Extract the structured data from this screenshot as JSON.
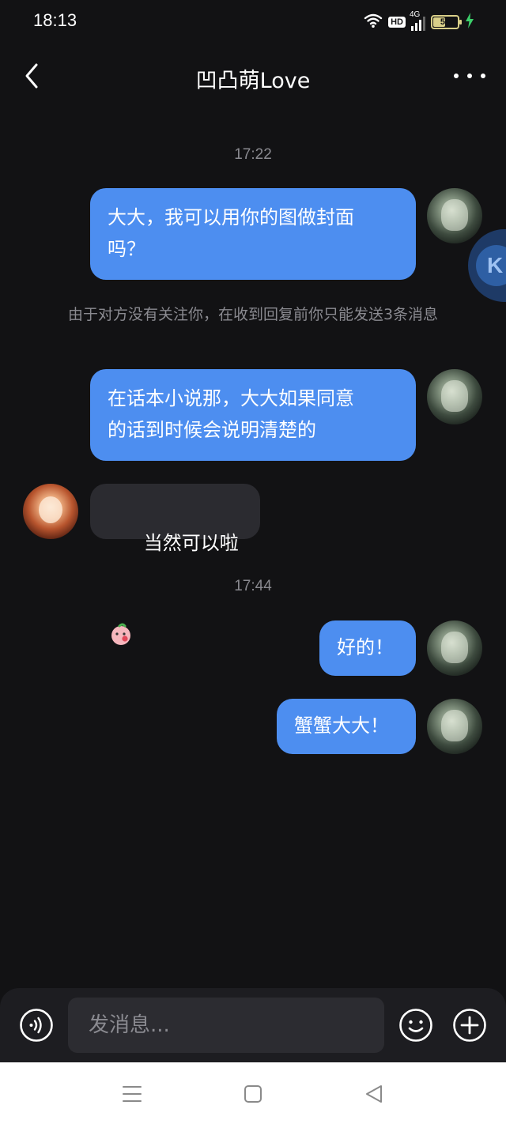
{
  "status_bar": {
    "time": "18:13",
    "hd": "HD",
    "network": "4G",
    "battery": "51",
    "battery_level_percent": 51
  },
  "header": {
    "title": "凹凸萌Love"
  },
  "messages": [
    {
      "type": "timestamp",
      "text": "17:22"
    },
    {
      "type": "outgoing",
      "text": "大大，我可以用你的图做封面\n吗？"
    },
    {
      "type": "notice",
      "text": "由于对方没有关注你，在收到回复前你只能发送3条消息"
    },
    {
      "type": "outgoing",
      "text": "在话本小说那，大大如果同意\n的话到时候会说明清楚的"
    },
    {
      "type": "incoming",
      "text": "当然可以啦",
      "emoji": "peach-blush-emoji"
    },
    {
      "type": "timestamp",
      "text": "17:44"
    },
    {
      "type": "outgoing",
      "text": "好的！"
    },
    {
      "type": "outgoing",
      "text": "蟹蟹大大！"
    }
  ],
  "input": {
    "placeholder": "发消息..."
  },
  "icons": {
    "back": "chevron-left-icon",
    "more": "more-dots-icon",
    "voice": "voice-icon",
    "emoji": "smiley-icon",
    "plus": "plus-icon",
    "nav_menu": "menu-icon",
    "nav_home": "home-square-icon",
    "nav_back": "back-triangle-icon"
  },
  "colors": {
    "background": "#121214",
    "outgoing_bubble": "#4d8ef0",
    "incoming_bubble": "#2b2b30",
    "muted_text": "#8a8a90"
  }
}
